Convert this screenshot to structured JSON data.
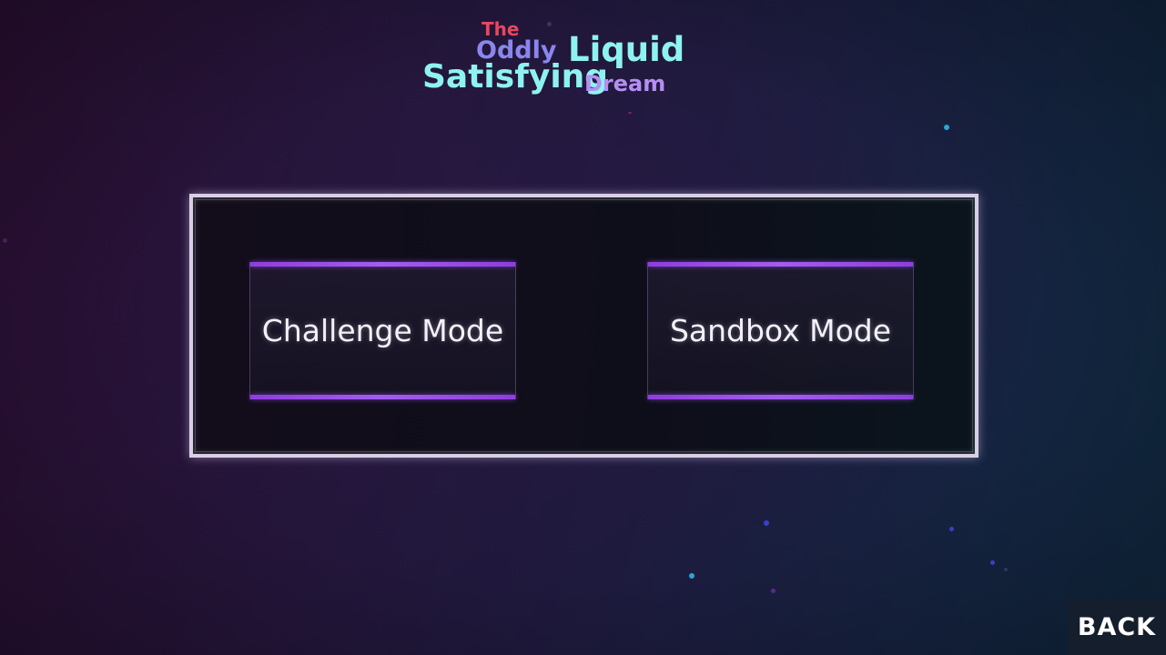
{
  "title": {
    "line_the": "The",
    "line_oddly": "Oddly",
    "line_liquid": "Liquid",
    "line_satisfying": "Satisfying",
    "line_dream": "Dream"
  },
  "mode_select": {
    "challenge_label": "Challenge Mode",
    "sandbox_label": "Sandbox Mode"
  },
  "navigation": {
    "back_label": "BACK"
  },
  "colors": {
    "title_the": "#e8475f",
    "title_oddly": "#8a86ee",
    "title_liquid": "#8ef3ef",
    "title_dream": "#b58ef2",
    "button_accent": "#a35cf0",
    "particle_cyan": "#2aa6d8",
    "particle_blue": "#3a3fd0",
    "particle_purple": "#5a2a90"
  }
}
